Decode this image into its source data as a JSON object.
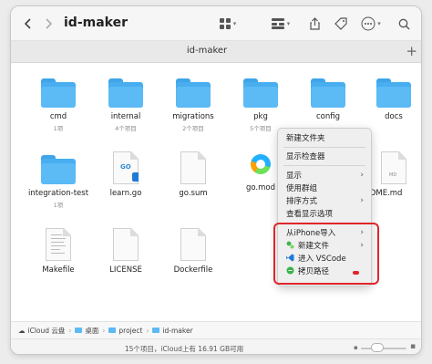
{
  "toolbar": {
    "title": "id-maker",
    "back_icon": "chevron-left-icon",
    "forward_icon": "chevron-right-icon",
    "view_icon": "grid-view-icon",
    "group_icon": "group-icon",
    "share_icon": "share-icon",
    "tag_icon": "tag-icon",
    "more_icon": "more-icon",
    "search_icon": "search-icon"
  },
  "tab": {
    "title": "id-maker",
    "add_label": "+"
  },
  "files": [
    {
      "name": "cmd",
      "sub": "1项",
      "kind": "folder"
    },
    {
      "name": "internal",
      "sub": "4个项目",
      "kind": "folder"
    },
    {
      "name": "migrations",
      "sub": "2个项目",
      "kind": "folder"
    },
    {
      "name": "pkg",
      "sub": "5个项目",
      "kind": "folder"
    },
    {
      "name": "config",
      "sub": "",
      "kind": "folder"
    },
    {
      "name": "docs",
      "sub": "",
      "kind": "folder"
    },
    {
      "name": "integration-test",
      "sub": "1项",
      "kind": "folder"
    },
    {
      "name": "learn.go",
      "sub": "",
      "kind": "go"
    },
    {
      "name": "go.sum",
      "sub": "",
      "kind": "doc"
    },
    {
      "name": "go.mod",
      "sub": "",
      "kind": "tencent"
    },
    {
      "name": "ADME.md",
      "sub": "",
      "kind": "md"
    },
    {
      "name": "Makefile",
      "sub": "",
      "kind": "text"
    },
    {
      "name": "LICENSE",
      "sub": "",
      "kind": "doc"
    },
    {
      "name": "Dockerfile",
      "sub": "",
      "kind": "doc"
    }
  ],
  "md_badge": "MD",
  "go_badge": "GO",
  "context_menu": {
    "new_folder": "新建文件夹",
    "show_inspector": "显示检查器",
    "show": "显示",
    "use_groups": "使用群组",
    "sort_by": "排序方式",
    "view_options": "查看显示选项",
    "import_iphone": "从iPhone导入",
    "new_file": "新建文件",
    "open_vscode": "进入 VSCode",
    "copy_path": "拷贝路径",
    "arrow": "›"
  },
  "pathbar": {
    "icloud": "iCloud 云盘",
    "desktop": "桌面",
    "project": "project",
    "idmaker": "id-maker",
    "sep": "›"
  },
  "status": {
    "text": "15个项目，iCloud上有 16.91 GB可用"
  },
  "colors": {
    "folder": "#48aef0",
    "highlight": "#e0262a"
  }
}
